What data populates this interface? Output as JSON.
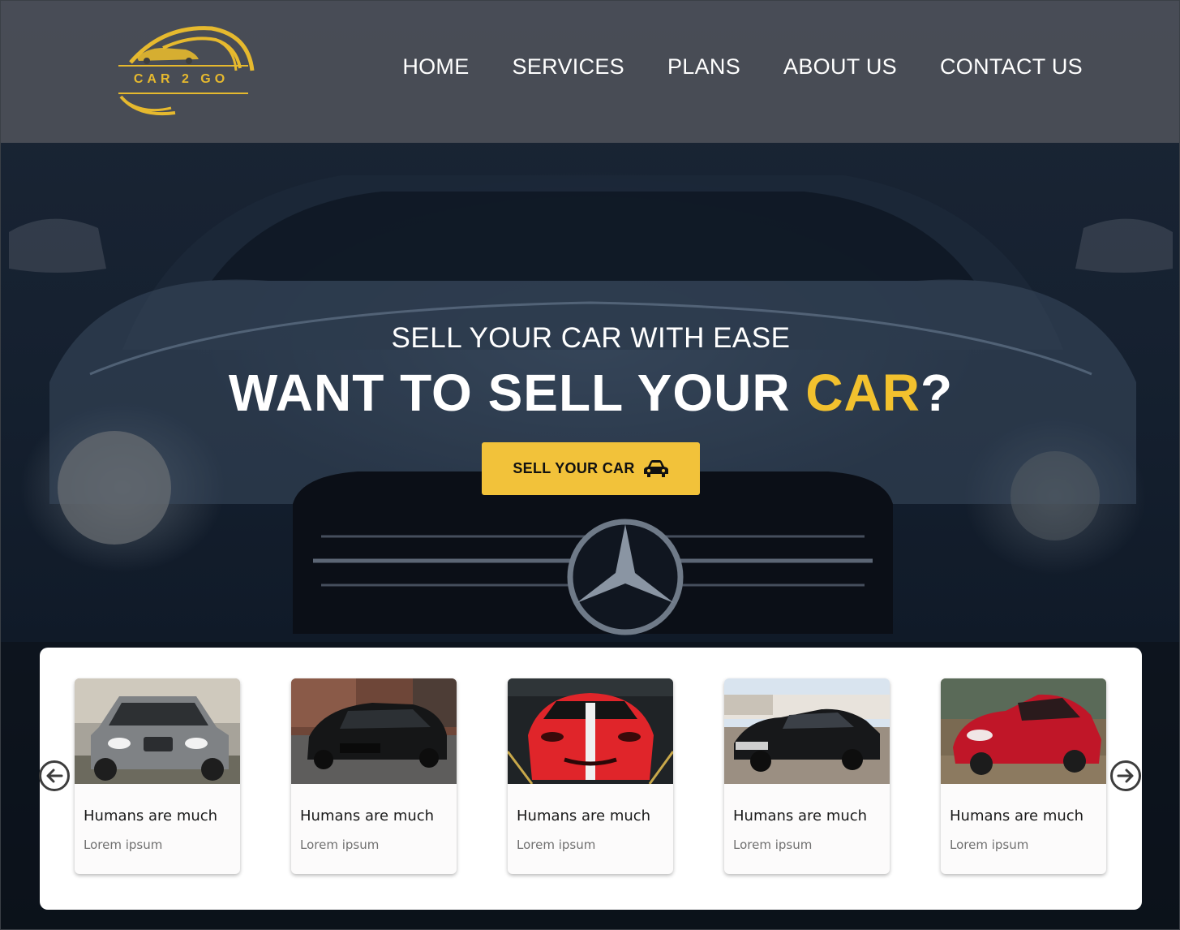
{
  "brand": {
    "logo_text": "CAR 2 GO",
    "accent_color": "#f2c12e"
  },
  "nav": {
    "items": [
      {
        "label": "HOME"
      },
      {
        "label": "SERVICES"
      },
      {
        "label": "PLANS"
      },
      {
        "label": "ABOUT US"
      },
      {
        "label": "CONTACT US"
      }
    ]
  },
  "hero": {
    "subtitle": "SELL YOUR CAR WITH EASE",
    "title_prefix": "WANT TO SELL YOUR ",
    "title_accent": "CAR",
    "title_suffix": "?",
    "cta_label": "SELL YOUR CAR",
    "cta_icon": "car-icon"
  },
  "carousel": {
    "prev_icon": "arrow-left-icon",
    "next_icon": "arrow-right-icon",
    "cards": [
      {
        "title": "Humans are much",
        "subtitle": "Lorem ipsum",
        "image": "silver-suv-photo"
      },
      {
        "title": "Humans are much",
        "subtitle": "Lorem ipsum",
        "image": "black-sedan-photo"
      },
      {
        "title": "Humans are much",
        "subtitle": "Lorem ipsum",
        "image": "red-sports-car-photo"
      },
      {
        "title": "Humans are much",
        "subtitle": "Lorem ipsum",
        "image": "black-muscle-car-photo"
      },
      {
        "title": "Humans are much",
        "subtitle": "Lorem ipsum",
        "image": "red-roadster-photo"
      }
    ]
  }
}
